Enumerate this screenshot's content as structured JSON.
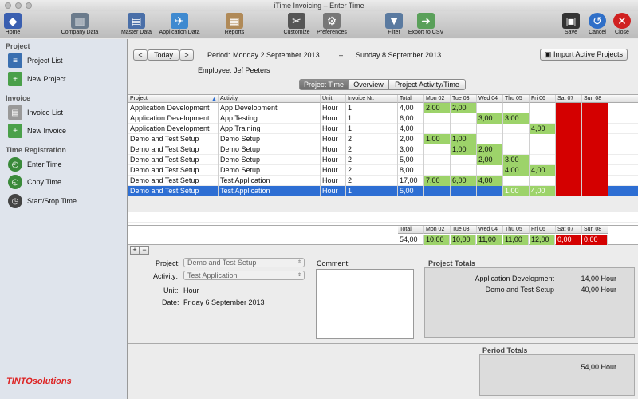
{
  "window": {
    "title": "iTime Invoicing – Enter Time"
  },
  "toolbar": {
    "home": "Home",
    "company_data": "Company Data",
    "master_data": "Master Data",
    "application_data": "Application Data",
    "reports": "Reports",
    "customize": "Customize",
    "preferences": "Preferences",
    "filter": "Filter",
    "export_csv": "Export to CSV",
    "save": "Save",
    "cancel": "Cancel",
    "close": "Close"
  },
  "sidebar": {
    "project_header": "Project",
    "project_list": "Project List",
    "new_project": "New Project",
    "invoice_header": "Invoice",
    "invoice_list": "Invoice List",
    "new_invoice": "New Invoice",
    "time_header": "Time Registration",
    "enter_time": "Enter Time",
    "copy_time": "Copy Time",
    "start_stop_time": "Start/Stop Time",
    "logo": "TINTOsolutions"
  },
  "nav": {
    "prev": "<",
    "today": "Today",
    "next": ">",
    "period_label": "Period:",
    "period_start": "Monday 2 September 2013",
    "dash": "–",
    "period_end": "Sunday 8 September 2013",
    "import_btn": "Import Active Projects",
    "employee": "Employee: Jef Peeters"
  },
  "tabs": [
    "Project Time",
    "Overview",
    "Project Activity/Time"
  ],
  "grid": {
    "headers": [
      "Project",
      "Activity",
      "Unit",
      "Invoice Nr.",
      "Total",
      "Mon 02",
      "Tue 03",
      "Wed 04",
      "Thu 05",
      "Fri 06",
      "Sat 07",
      "Sun 08"
    ],
    "rows": [
      [
        "Application Development",
        "App Development",
        "Hour",
        "1",
        "4,00",
        "2,00",
        "2,00",
        "",
        "",
        "",
        "",
        ""
      ],
      [
        "Application Development",
        "App Testing",
        "Hour",
        "1",
        "6,00",
        "",
        "",
        "3,00",
        "3,00",
        "",
        "",
        ""
      ],
      [
        "Application Development",
        "App Training",
        "Hour",
        "1",
        "4,00",
        "",
        "",
        "",
        "",
        "4,00",
        "",
        ""
      ],
      [
        "Demo and Test Setup",
        "Demo Setup",
        "Hour",
        "2",
        "2,00",
        "1,00",
        "1,00",
        "",
        "",
        "",
        "",
        ""
      ],
      [
        "Demo and Test Setup",
        "Demo Setup",
        "Hour",
        "2",
        "3,00",
        "",
        "1,00",
        "2,00",
        "",
        "",
        "",
        ""
      ],
      [
        "Demo and Test Setup",
        "Demo Setup",
        "Hour",
        "2",
        "5,00",
        "",
        "",
        "2,00",
        "3,00",
        "",
        "",
        ""
      ],
      [
        "Demo and Test Setup",
        "Demo Setup",
        "Hour",
        "2",
        "8,00",
        "",
        "",
        "",
        "4,00",
        "4,00",
        "",
        ""
      ],
      [
        "Demo and Test Setup",
        "Test Application",
        "Hour",
        "2",
        "17,00",
        "7,00",
        "6,00",
        "4,00",
        "",
        "",
        "",
        ""
      ],
      [
        "Demo and Test Setup",
        "Test Application",
        "Hour",
        "1",
        "5,00",
        "",
        "",
        "",
        "1,00",
        "4,00",
        "",
        ""
      ]
    ],
    "totals_header": [
      "Total",
      "Mon 02",
      "Tue 03",
      "Wed 04",
      "Thu 05",
      "Fri 06",
      "Sat 07",
      "Sun 08"
    ],
    "totals": [
      "54,00",
      "10,00",
      "10,00",
      "11,00",
      "11,00",
      "12,00",
      "0,00",
      "0,00"
    ],
    "add": "+",
    "remove": "−"
  },
  "detail": {
    "project_label": "Project:",
    "project_value": "Demo and Test Setup",
    "activity_label": "Activity:",
    "activity_value": "Test Application",
    "unit_label": "Unit:",
    "unit_value": "Hour",
    "date_label": "Date:",
    "date_value": "Friday 6 September 2013",
    "comment_label": "Comment:"
  },
  "project_totals": {
    "title": "Project Totals",
    "items": [
      {
        "name": "Application Development",
        "value": "14,00",
        "unit": "Hour"
      },
      {
        "name": "Demo and Test Setup",
        "value": "40,00",
        "unit": "Hour"
      }
    ]
  },
  "period_totals": {
    "title": "Period Totals",
    "value": "54,00",
    "unit": "Hour"
  }
}
